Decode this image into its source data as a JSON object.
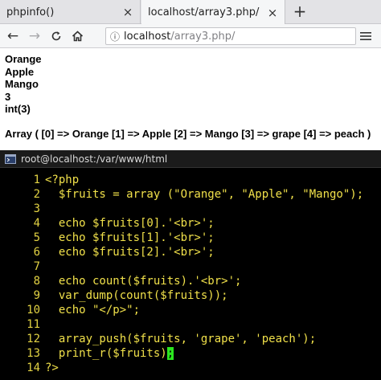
{
  "tabs": [
    {
      "label": "phpinfo()",
      "close": "×"
    },
    {
      "label": "localhost/array3.php/",
      "close": "×"
    }
  ],
  "new_tab": "+",
  "nav": {
    "back": "←",
    "forward": "→",
    "reload": "C",
    "home": "⌂",
    "info": "ⓘ",
    "url_host": "localhost",
    "url_path": "/array3.php/"
  },
  "page": {
    "lines": [
      "Orange",
      "Apple",
      "Mango",
      "3",
      "int(3)"
    ],
    "print_r": "Array ( [0] => Orange [1] => Apple [2] => Mango [3] => grape [4] => peach )"
  },
  "terminal": {
    "title": "root@localhost:/var/www/html",
    "code": [
      {
        "n": "1",
        "text": "<?php"
      },
      {
        "n": "2",
        "text": "  $fruits = array (\"Orange\", \"Apple\", \"Mango\");"
      },
      {
        "n": "3",
        "text": ""
      },
      {
        "n": "4",
        "text": "  echo $fruits[0].'<br>';"
      },
      {
        "n": "5",
        "text": "  echo $fruits[1].'<br>';"
      },
      {
        "n": "6",
        "text": "  echo $fruits[2].'<br>';"
      },
      {
        "n": "7",
        "text": ""
      },
      {
        "n": "8",
        "text": "  echo count($fruits).'<br>';"
      },
      {
        "n": "9",
        "text": "  var_dump(count($fruits));"
      },
      {
        "n": "10",
        "text": "  echo \"</p>\";"
      },
      {
        "n": "11",
        "text": ""
      },
      {
        "n": "12",
        "text": "  array_push($fruits, 'grape', 'peach');"
      },
      {
        "n": "13",
        "text": "  print_r($fruits)",
        "cursor_char": ";"
      },
      {
        "n": "14",
        "text": "?>"
      }
    ],
    "tilde": "~"
  },
  "colors": {
    "code_text": "#f0e04a",
    "line_numbers": "#e2d243",
    "cursor": "#2be61f",
    "tilde": "#3a6cff",
    "terminal_bg": "#000000"
  }
}
